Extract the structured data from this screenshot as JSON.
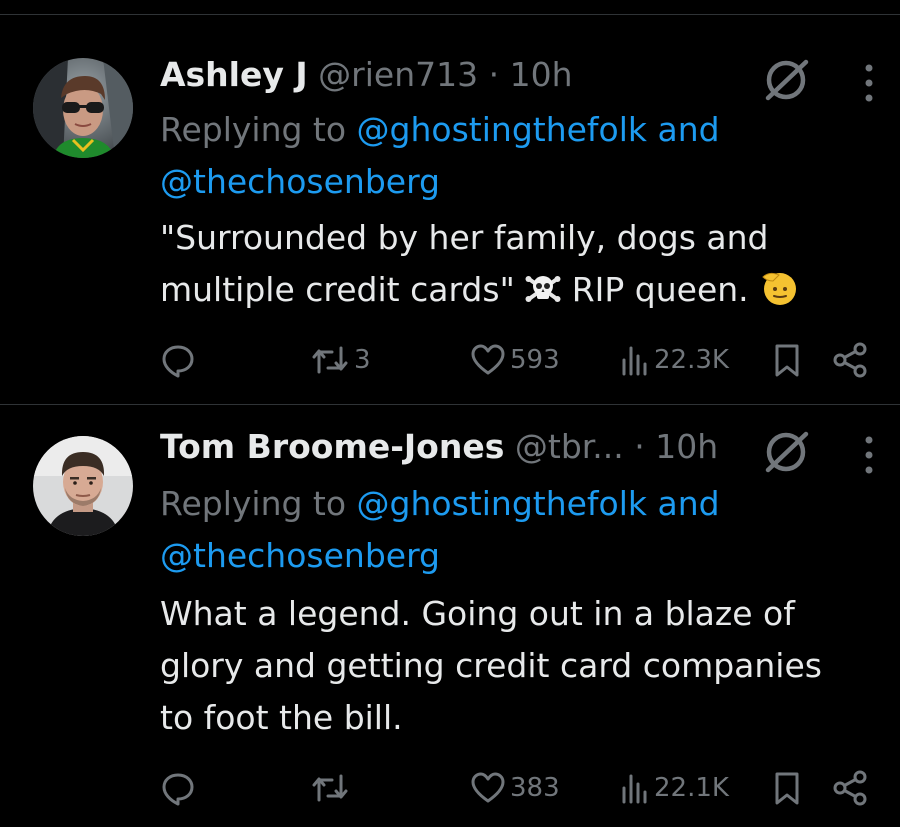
{
  "tweets": [
    {
      "name": "Ashley J",
      "handle": "@rien713",
      "dot": "·",
      "time": "10h",
      "replying_prefix": "Replying to",
      "mention1": "@ghostingthefolk",
      "and_word": "and",
      "mention2": "@thechosenberg",
      "text_line1": "\"Surrounded by her family, dogs and",
      "text_line2a": "multiple credit cards\"",
      "text_line2b": "RIP queen.",
      "emoji1": "skull-and-crossbones-icon",
      "emoji2": "saluting-face-icon",
      "stats": {
        "replies": "",
        "reposts": "3",
        "likes": "593",
        "views": "22.3K"
      }
    },
    {
      "name": "Tom Broome-Jones",
      "handle": "@tbr...",
      "dot": "·",
      "time": "10h",
      "replying_prefix": "Replying to",
      "mention1": "@ghostingthefolk",
      "and_word": "and",
      "mention2": "@thechosenberg",
      "text_line1": "What a legend. Going out in a blaze of",
      "text_line2": "glory and getting credit card companies",
      "text_line3": "to foot the bill.",
      "stats": {
        "replies": "",
        "reposts": "",
        "likes": "383",
        "views": "22.1K"
      }
    }
  ],
  "colors": {
    "background": "#000000",
    "text": "#e7e9ea",
    "secondary": "#71767b",
    "link": "#1d9bf0",
    "divider": "#2f3336"
  }
}
